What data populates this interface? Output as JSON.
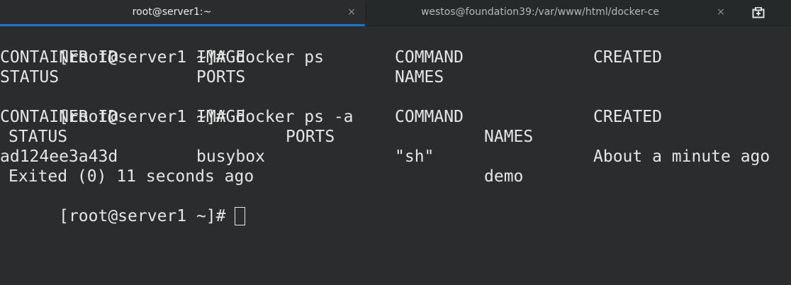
{
  "tabs": [
    {
      "title": "root@server1:~",
      "close": "×"
    },
    {
      "title": "westos@foundation39:/var/www/html/docker-ce",
      "close": "×"
    }
  ],
  "terminal": {
    "prompt": "[root@server1 ~]#",
    "cmd1": "docker ps",
    "h1": {
      "container_id": "CONTAINER ID",
      "image": "IMAGE",
      "command": "COMMAND",
      "created": "CREATED"
    },
    "h1b": {
      "status": "STATUS",
      "ports": "PORTS",
      "names": "NAMES"
    },
    "cmd2": "docker ps -a",
    "h2": {
      "container_id": "CONTAINER ID",
      "image": "IMAGE",
      "command": "COMMAND",
      "created": "CREATED"
    },
    "h2b": {
      "status": "STATUS",
      "ports": "PORTS",
      "names": "NAMES"
    },
    "row": {
      "container_id": "ad124ee3a43d",
      "image": "busybox",
      "command": "\"sh\"",
      "created": "About a minute ago",
      "status": "Exited (0) 11 seconds ago",
      "names": "demo"
    }
  },
  "colors": {
    "accent": "#1b75d0",
    "background": "#2a2c2d",
    "text": "#e6e6e6"
  },
  "icons": {
    "new_tab": "new-tab-icon",
    "close": "close-icon"
  }
}
